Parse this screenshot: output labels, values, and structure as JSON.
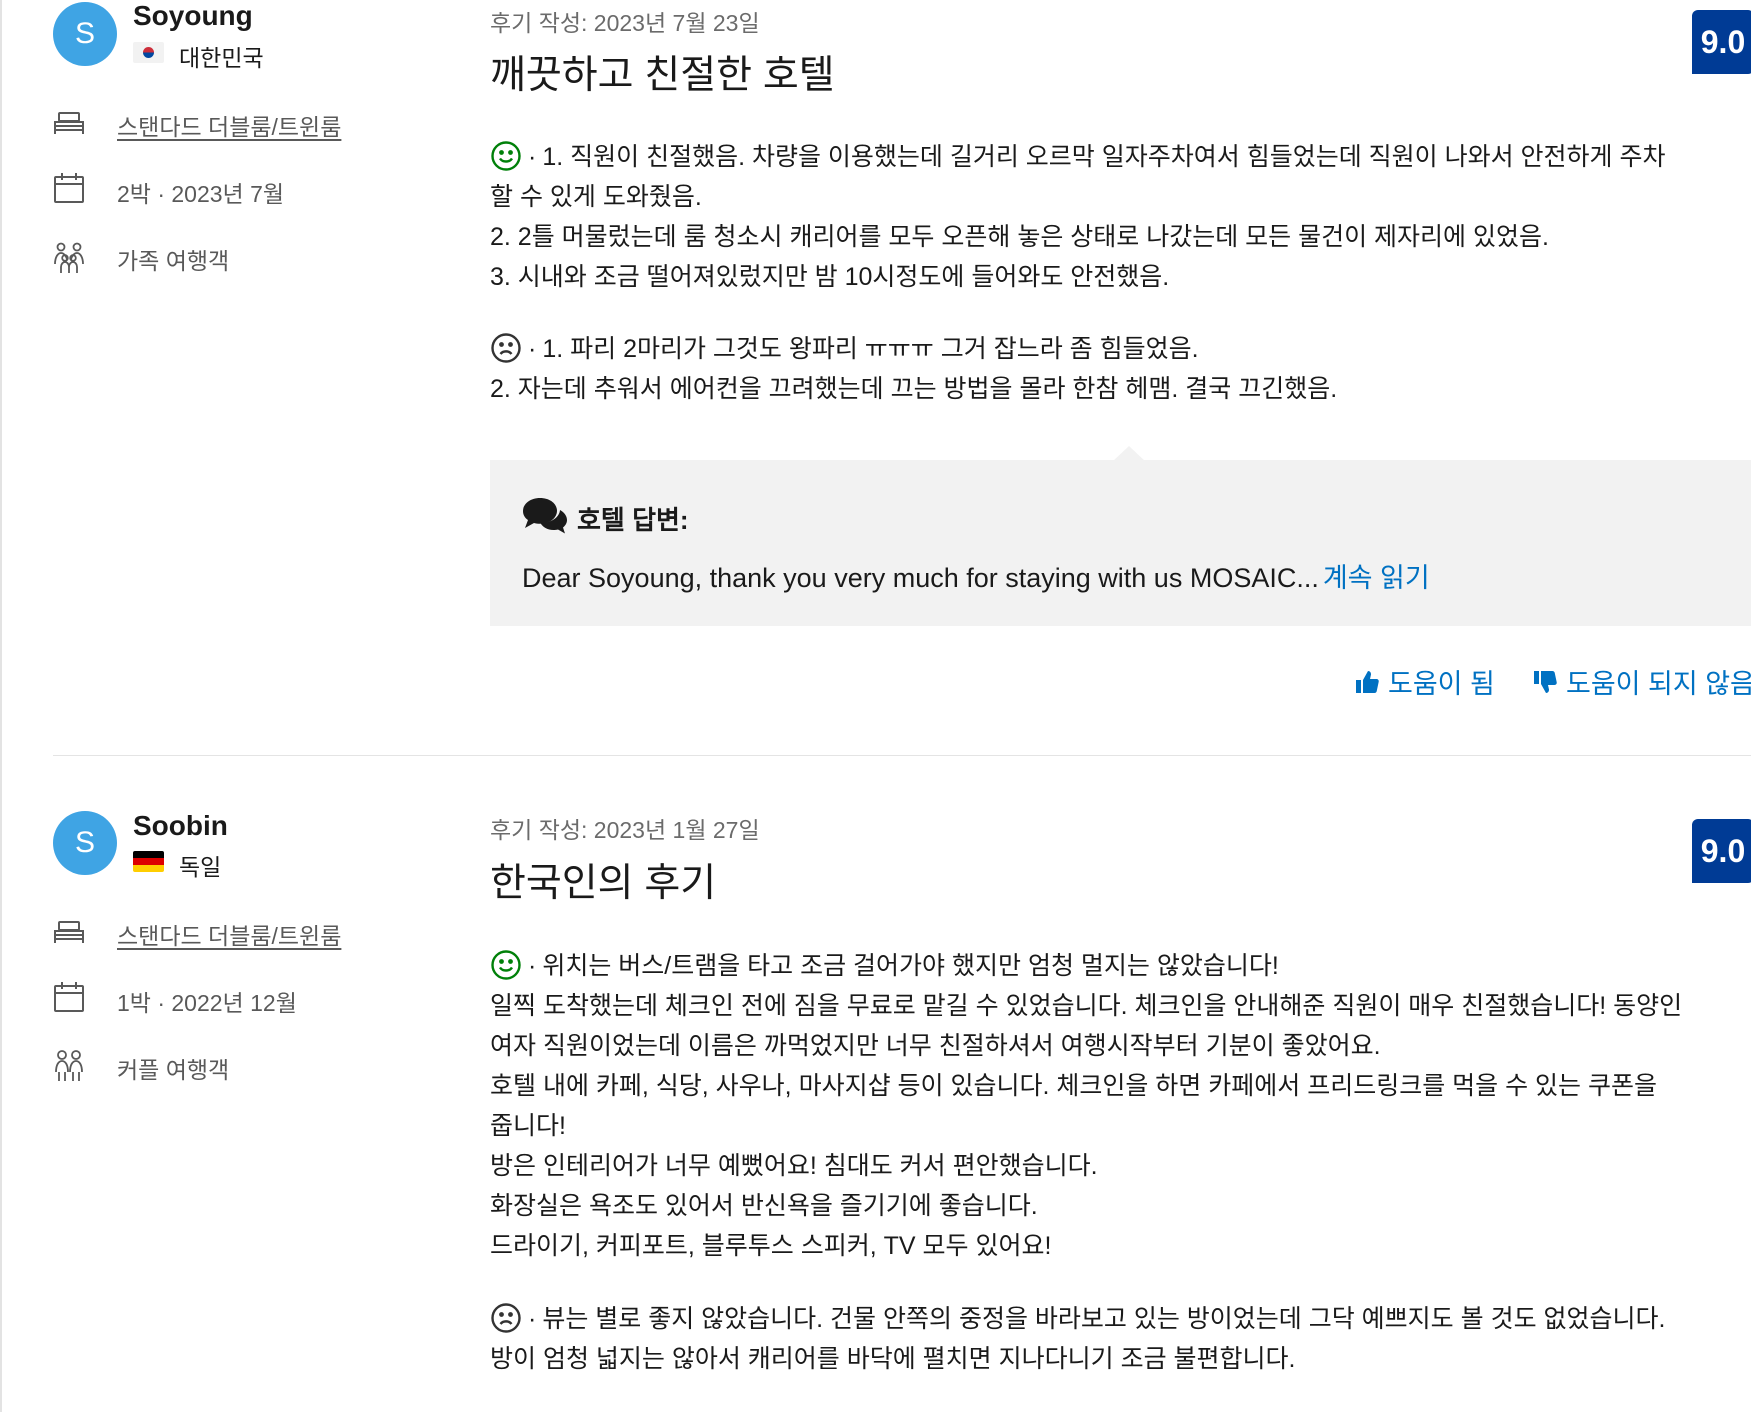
{
  "reviews": [
    {
      "avatar_letter": "S",
      "name": "Soyoung",
      "country": "대한민국",
      "flag": "kr",
      "room": "스탠다드 더블룸/트윈룸",
      "stay": "2박 · 2023년 7월",
      "traveler_type": "가족 여행객",
      "date": "후기 작성: 2023년 7월 23일",
      "title": "깨끗하고 친절한 호텔",
      "score": "9.0",
      "positive": [
        "1. 직원이 친절했음. 차량을 이용했는데 길거리 오르막 일자주차여서 힘들었는데 직원이 나와서 안전하게 주차",
        "할 수 있게 도와줬음.",
        "2. 2틀 머물렀는데 룸 청소시 캐리어를 모두 오픈해 놓은 상태로 나갔는데 모든 물건이 제자리에 있었음.",
        "3. 시내와 조금 떨어져있렀지만 밤 10시정도에 들어와도 안전했음."
      ],
      "negative": [
        "1. 파리 2마리가 그것도 왕파리 ㅠㅠㅠ 그거 잡느라 좀 힘들었음.",
        "2. 자는데 추워서 에어컨을 끄려했는데 끄는 방법을 몰라 한참 헤맴. 결국 끄긴했음."
      ],
      "hotel_reply": {
        "title": "호텔 답변:",
        "text": "Dear Soyoung, thank you very much for staying with us MOSAIC...",
        "read_more": "계속 읽기"
      },
      "helpful_label": "도움이 됨",
      "not_helpful_label": "도움이 되지 않음"
    },
    {
      "avatar_letter": "S",
      "name": "Soobin",
      "country": "독일",
      "flag": "de",
      "room": "스탠다드 더블룸/트윈룸",
      "stay": "1박 · 2022년 12월",
      "traveler_type": "커플 여행객",
      "date": "후기 작성: 2023년 1월 27일",
      "title": "한국인의 후기",
      "score": "9.0",
      "positive": [
        "위치는 버스/트램을 타고 조금 걸어가야 했지만 엄청 멀지는 않았습니다!",
        "일찍 도착했는데 체크인 전에 짐을 무료로 맡길 수 있었습니다. 체크인을 안내해준 직원이 매우 친절했습니다! 동양인",
        "여자 직원이었는데 이름은 까먹었지만 너무 친절하셔서 여행시작부터 기분이 좋았어요.",
        "호텔 내에 카페, 식당, 사우나, 마사지샵 등이 있습니다. 체크인을 하면 카페에서 프리드링크를 먹을 수 있는 쿠폰을",
        "줍니다!",
        "방은 인테리어가 너무 예뻤어요! 침대도 커서 편안했습니다.",
        "화장실은 욕조도 있어서 반신욕을 즐기기에 좋습니다.",
        "드라이기, 커피포트, 블루투스 스피커, TV 모두 있어요!"
      ],
      "negative": [
        "뷰는 별로 좋지 않았습니다. 건물 안쪽의 중정을 바라보고 있는 방이었는데 그닥 예쁘지도 볼 것도 없었습니다.",
        "방이 엄청 넓지는 않아서 캐리어를 바닥에 펼치면 지나다니기 조금 불편합니다."
      ]
    }
  ],
  "icons": {
    "room": "bed-icon",
    "stay": "calendar-icon",
    "family": "family-group-icon",
    "couple": "couple-icon",
    "positive": "smiley-face-icon",
    "negative": "sad-face-icon",
    "reply": "speech-bubbles-icon",
    "helpful": "thumbs-up-icon",
    "not_helpful": "thumbs-down-icon"
  },
  "colors": {
    "score_badge": "#003b95",
    "link": "#0071c2",
    "avatar": "#3fa4e4",
    "positive_face": "#008009",
    "reply_bg": "#f2f2f2"
  }
}
